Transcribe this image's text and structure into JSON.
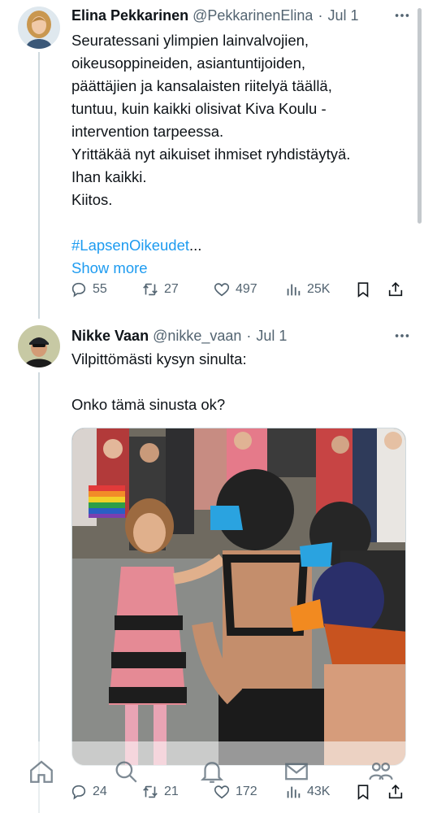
{
  "tweets": [
    {
      "author": {
        "name": "Elina Pekkarinen",
        "handle": "@PekkarinenElina",
        "avatar": "avatar-woman-blonde"
      },
      "date": "Jul 1",
      "lines": [
        "Seuratessani ylimpien lainvalvojien,",
        "oikeusoppineiden, asiantuntijoiden,",
        "päättäjien ja kansalaisten riitelyä täällä,",
        "tuntuu, kuin kaikki olisivat Kiva Koulu -",
        "intervention tarpeessa.",
        "Yrittäkää nyt aikuiset ihmiset ryhdistäytyä.",
        "Ihan kaikki.",
        "Kiitos."
      ],
      "hashtag": "#LapsenOikeudet",
      "ellipsis": "...",
      "show_more": "Show more",
      "stats": {
        "replies": "55",
        "retweets": "27",
        "likes": "497",
        "views": "25K"
      }
    },
    {
      "author": {
        "name": "Nikke Vaan",
        "handle": "@nikke_vaan",
        "avatar": "avatar-man-cap"
      },
      "date": "Jul 1",
      "lines": [
        "Vilpittömästi kysyn sinulta:",
        "",
        "Onko tämä sinusta ok?"
      ],
      "media": "photo-street-parade",
      "stats": {
        "replies": "24",
        "retweets": "21",
        "likes": "172",
        "views": "43K"
      }
    }
  ],
  "nav": [
    "home-icon",
    "search-icon",
    "notifications-icon",
    "messages-icon",
    "communities-icon"
  ],
  "colors": {
    "text": "#0f1419",
    "secondary": "#536471",
    "link": "#1d9bf0",
    "line": "#cfd9de"
  }
}
